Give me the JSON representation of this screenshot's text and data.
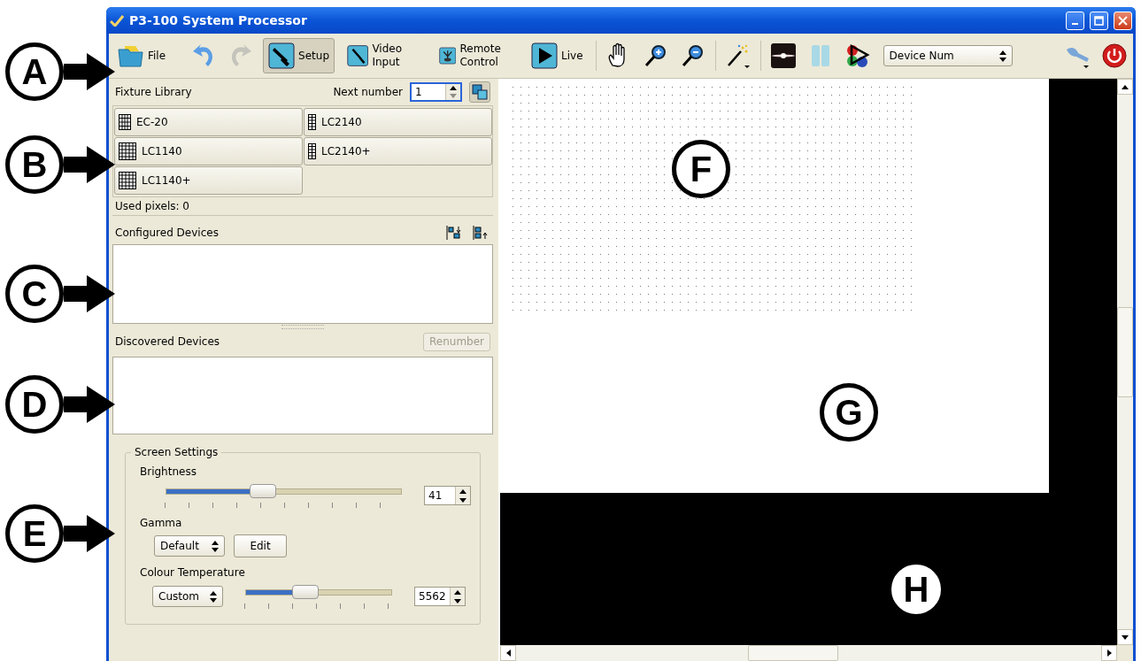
{
  "callouts": [
    {
      "label": "A"
    },
    {
      "label": "B"
    },
    {
      "label": "C"
    },
    {
      "label": "D"
    },
    {
      "label": "E"
    },
    {
      "label": "F"
    },
    {
      "label": "G"
    },
    {
      "label": "H"
    }
  ],
  "window": {
    "title": "P3-100 System Processor"
  },
  "toolbar": {
    "file": {
      "label": "File"
    },
    "redo": {
      "disabled": true
    },
    "modes": [
      {
        "label": "Setup",
        "selected": true
      },
      {
        "label": "Video Input",
        "selected": false
      },
      {
        "label": "Remote Control",
        "selected": false
      },
      {
        "label": "Live",
        "selected": false
      }
    ],
    "view_select": {
      "value": "Device Num"
    }
  },
  "fixture_library": {
    "title": "Fixture Library",
    "next_number_label": "Next number",
    "next_number": "1",
    "fixtures": [
      {
        "name": "EC-20",
        "kind": "square"
      },
      {
        "name": "LC2140",
        "kind": "column"
      },
      {
        "name": "LC1140",
        "kind": "grid"
      },
      {
        "name": "LC2140+",
        "kind": "column"
      },
      {
        "name": "LC1140+",
        "kind": "grid"
      }
    ],
    "used_pixels": "Used pixels: 0"
  },
  "configured_devices": {
    "title": "Configured Devices"
  },
  "discovered_devices": {
    "title": "Discovered Devices",
    "renumber": {
      "label": "Renumber",
      "disabled": true
    }
  },
  "screen_settings": {
    "title": "Screen Settings",
    "brightness": {
      "label": "Brightness",
      "level": 0.41,
      "value": "41"
    },
    "gamma": {
      "label": "Gamma",
      "select": "Default",
      "edit": "Edit"
    },
    "colour_temperature": {
      "label": "Colour Temperature",
      "preset": "Custom",
      "level": 0.41,
      "value": "5562"
    }
  }
}
